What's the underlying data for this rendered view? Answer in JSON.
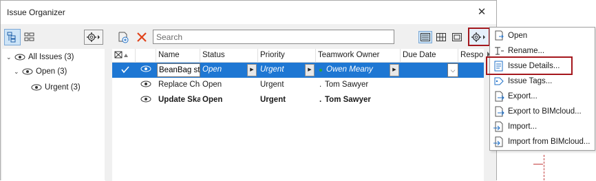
{
  "window": {
    "title": "Issue Organizer",
    "close_glyph": "✕"
  },
  "tree": {
    "items": [
      {
        "label": "All Issues (3)"
      },
      {
        "label": "Open (3)"
      },
      {
        "label": "Urgent (3)"
      }
    ]
  },
  "search": {
    "placeholder": "Search"
  },
  "table": {
    "columns": [
      "Name",
      "Status",
      "Priority",
      "Teamwork Owner",
      "Due Date",
      "Respo"
    ],
    "rows": [
      {
        "name": "BeanBag st",
        "status": "Open",
        "priority": "Urgent",
        "owner": "Owen Meany",
        "due": "",
        "selected": true
      },
      {
        "name": "Replace Cha",
        "status": "Open",
        "priority": "Urgent",
        "owner": "Tom Sawyer",
        "due": "",
        "bold": false
      },
      {
        "name": "Update Ska",
        "status": "Open",
        "priority": "Urgent",
        "owner": "Tom Sawyer",
        "due": "",
        "bold": true
      }
    ]
  },
  "menu": {
    "items": [
      {
        "label": "Open",
        "icon": "open-icon"
      },
      {
        "label": "Rename...",
        "icon": "rename-icon"
      },
      {
        "label": "Issue Details...",
        "icon": "issue-details-icon"
      },
      {
        "label": "Issue Tags...",
        "icon": "issue-tags-icon"
      },
      {
        "label": "Export...",
        "icon": "export-icon"
      },
      {
        "label": "Export to BIMcloud...",
        "icon": "export-bimcloud-icon"
      },
      {
        "label": "Import...",
        "icon": "import-icon"
      },
      {
        "label": "Import from BIMcloud...",
        "icon": "import-bimcloud-icon"
      }
    ]
  },
  "colors": {
    "selection": "#1e77d3",
    "highlight_border": "#a4161c",
    "delete_x": "#e0431b",
    "owner_dot": "#27a63a"
  }
}
